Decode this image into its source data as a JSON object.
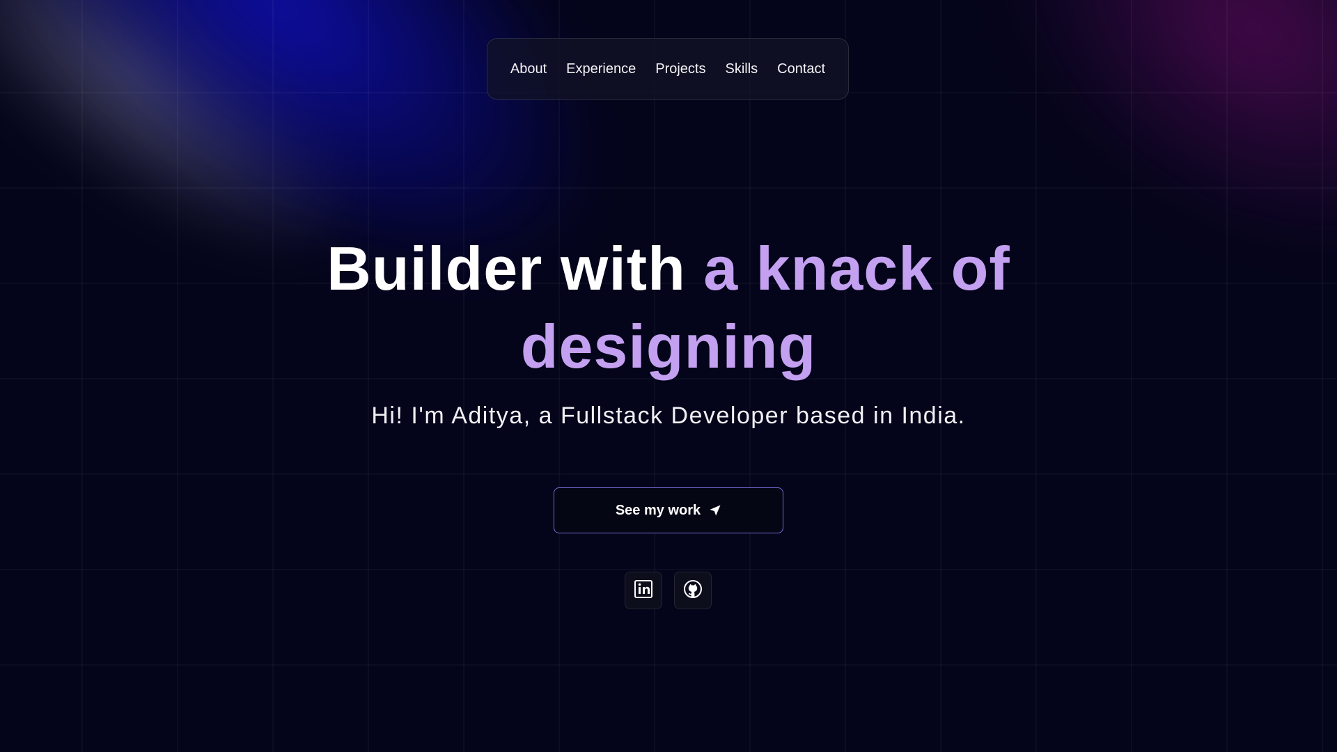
{
  "nav": {
    "items": [
      {
        "label": "About"
      },
      {
        "label": "Experience"
      },
      {
        "label": "Projects"
      },
      {
        "label": "Skills"
      },
      {
        "label": "Contact"
      }
    ]
  },
  "hero": {
    "headline_plain": "Builder with ",
    "headline_accent": "a knack of designing",
    "subtitle": "Hi! I'm Aditya, a Fullstack Developer based in India.",
    "cta_label": "See my work",
    "cta_icon": "send-arrow-icon"
  },
  "social": [
    {
      "icon": "linkedin-icon"
    },
    {
      "icon": "github-icon"
    }
  ],
  "colors": {
    "background": "#04041a",
    "accent_text": "#c3a0f0",
    "cta_border": "#7a6fd8",
    "glow_blue": "#1010be",
    "glow_magenta": "#5a0a5a"
  }
}
